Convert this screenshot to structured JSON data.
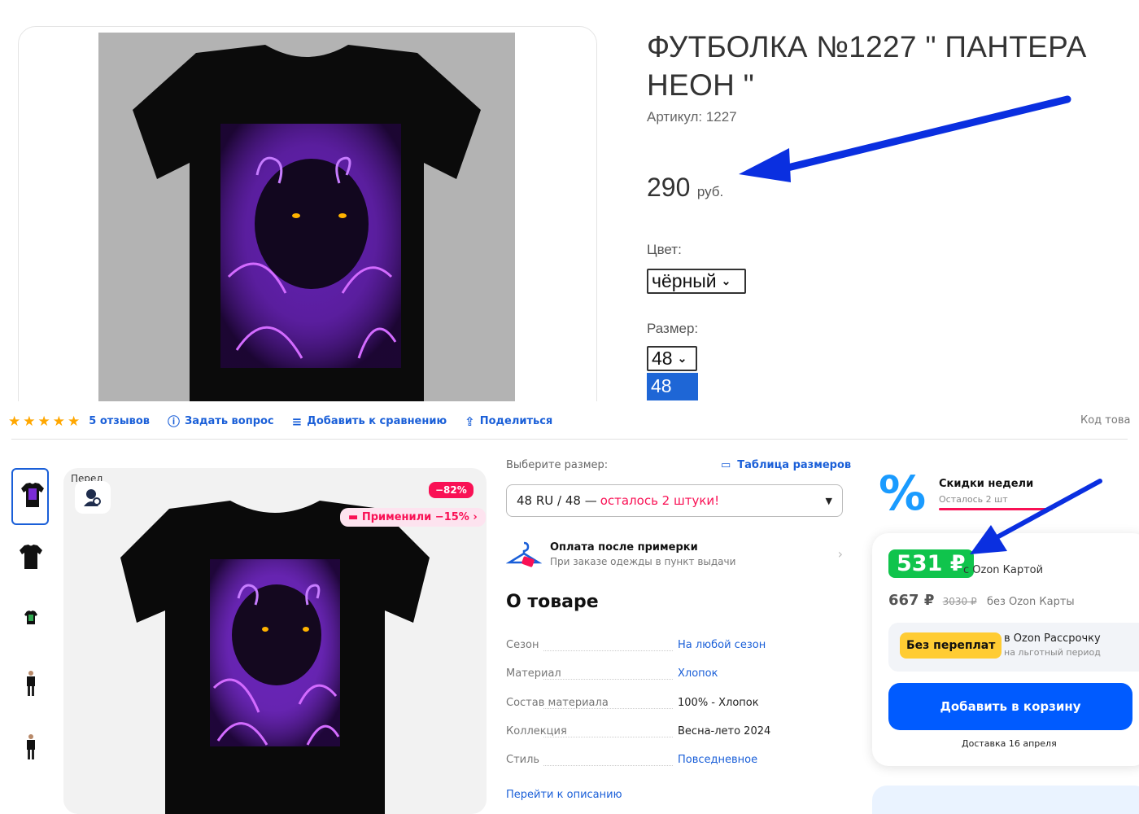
{
  "top": {
    "title": "ФУТБОЛКА №1227 \" ПАНТЕРА НЕОН \"",
    "sku": "Артикул: 1227",
    "price_value": "290",
    "price_currency": "руб.",
    "color_label": "Цвет:",
    "color_value": "чёрный",
    "size_label": "Размер:",
    "size_value": "48",
    "size_option_highlight": "48"
  },
  "bottom": {
    "rating_stars": 5,
    "reviews": "5 отзывов",
    "ask_question": "Задать вопрос",
    "add_compare": "Добавить к сравнению",
    "share": "Поделиться",
    "product_code": "Код това",
    "fit_label": "Перед",
    "discount_badge": "−82%",
    "apply_promo": "Применили −15% ›",
    "size_prompt": "Выберите размер:",
    "size_table": "Таблица размеров",
    "size_select": {
      "value": "48 RU / 48 —",
      "remaining": "осталось 2 штуки!"
    },
    "payment": {
      "title": "Оплата после примерки",
      "subtitle": "При заказе одежды в пункт выдачи"
    },
    "about_title": "О товаре",
    "characteristics": [
      {
        "key": "Сезон",
        "value": "На любой сезон",
        "link": true
      },
      {
        "key": "Материал",
        "value": "Хлопок",
        "link": true
      },
      {
        "key": "Состав материала",
        "value": "100% - Хлопок",
        "link": false
      },
      {
        "key": "Коллекция",
        "value": "Весна-лето 2024",
        "link": false
      },
      {
        "key": "Стиль",
        "value": "Повседневное",
        "link": true
      }
    ],
    "goto_description": "Перейти к описанию",
    "weekly": {
      "icon": "%",
      "title": "Скидки недели",
      "subtitle": "Осталось 2 шт"
    },
    "buy_box": {
      "ozon_price": "531 ₽",
      "ozon_card_label": "с Ozon Картой",
      "regular_price": "667 ₽",
      "old_price": "3030 ₽",
      "no_card_label": "без Ozon Карты",
      "installment_badge": "Без переплат",
      "installment_title": "в Ozon Рассрочку",
      "installment_sub": "на льготный период",
      "add_to_cart": "Добавить в корзину",
      "delivery": "Доставка 16 апреля"
    }
  },
  "colors": {
    "accent_blue": "#1a5fd8",
    "ozon_blue": "#005bff",
    "ozon_green": "#10c44c",
    "pink": "#f91155",
    "arrow_blue": "#0a2fe0"
  }
}
